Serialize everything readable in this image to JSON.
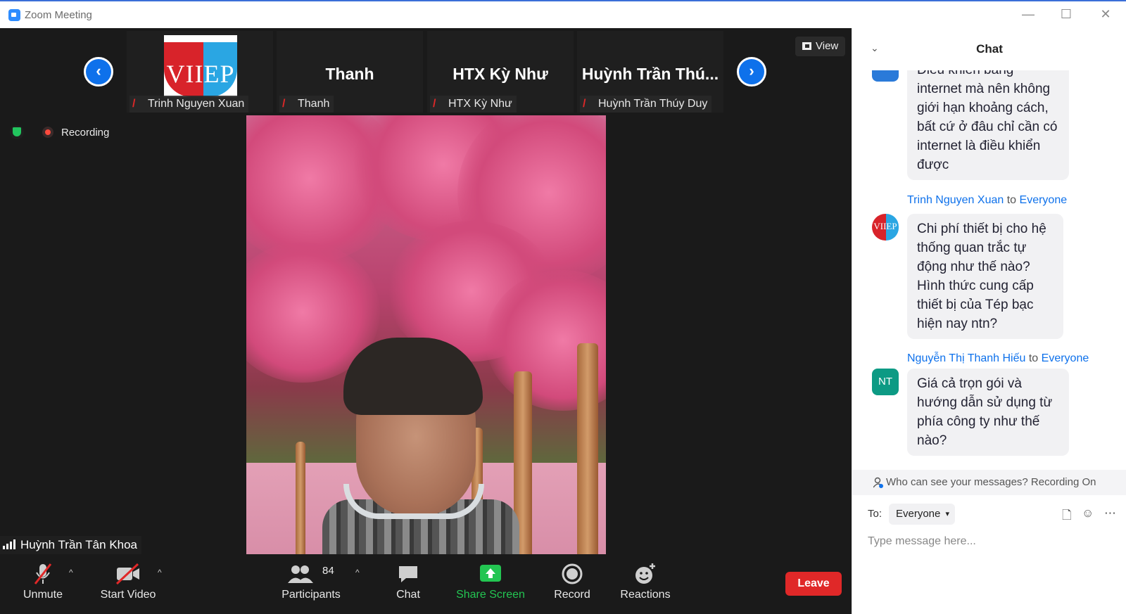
{
  "window": {
    "title": "Zoom Meeting",
    "minimize": "—",
    "maximize": "☐",
    "close": "✕"
  },
  "thumbnails": {
    "prev": "‹",
    "next": "›",
    "tiles": [
      {
        "big_name": "",
        "name_tag": "Trinh Nguyen Xuan",
        "logo_text": "VIIEP"
      },
      {
        "big_name": "Thanh",
        "name_tag": "Thanh"
      },
      {
        "big_name": "HTX Kỳ Như",
        "name_tag": "HTX Kỳ Như"
      },
      {
        "big_name": "Huỳnh Trần Thú...",
        "name_tag": "Huỳnh Trần Thúy Duy"
      }
    ]
  },
  "view_button": "View",
  "status": {
    "recording": "Recording"
  },
  "active_speaker": "Huỳnh Trần Tân Khoa",
  "toolbar": {
    "unmute": "Unmute",
    "start_video": "Start Video",
    "participants": "Participants",
    "participants_count": "84",
    "chat": "Chat",
    "share_screen": "Share Screen",
    "record": "Record",
    "reactions": "Reactions",
    "leave": "Leave",
    "caret": "^"
  },
  "chat": {
    "title": "Chat",
    "messages": [
      {
        "text": "Điều khiển bằng internet mà nên không giới hạn khoảng cách, bất cứ ở đâu chỉ cần có internet là điều khiển được"
      },
      {
        "sender": "Trinh Nguyen Xuan",
        "to_word": "to",
        "recipient": "Everyone",
        "avatar": "VIIEP",
        "text": "Chi phí thiết bị cho hệ thống quan trắc tự động như thế nào? Hình thức cung cấp thiết bị của Tép bạc hiện nay ntn?"
      },
      {
        "sender": "Nguyễn Thị Thanh Hiếu",
        "to_word": "to",
        "recipient": "Everyone",
        "avatar": "NT",
        "text": "Giá cả trọn gói và hướng dẫn sử dụng từ phía công ty như thế nào?"
      }
    ],
    "privacy": "Who can see your messages? Recording On",
    "to_label": "To:",
    "to_value": "Everyone",
    "placeholder": "Type message here..."
  }
}
